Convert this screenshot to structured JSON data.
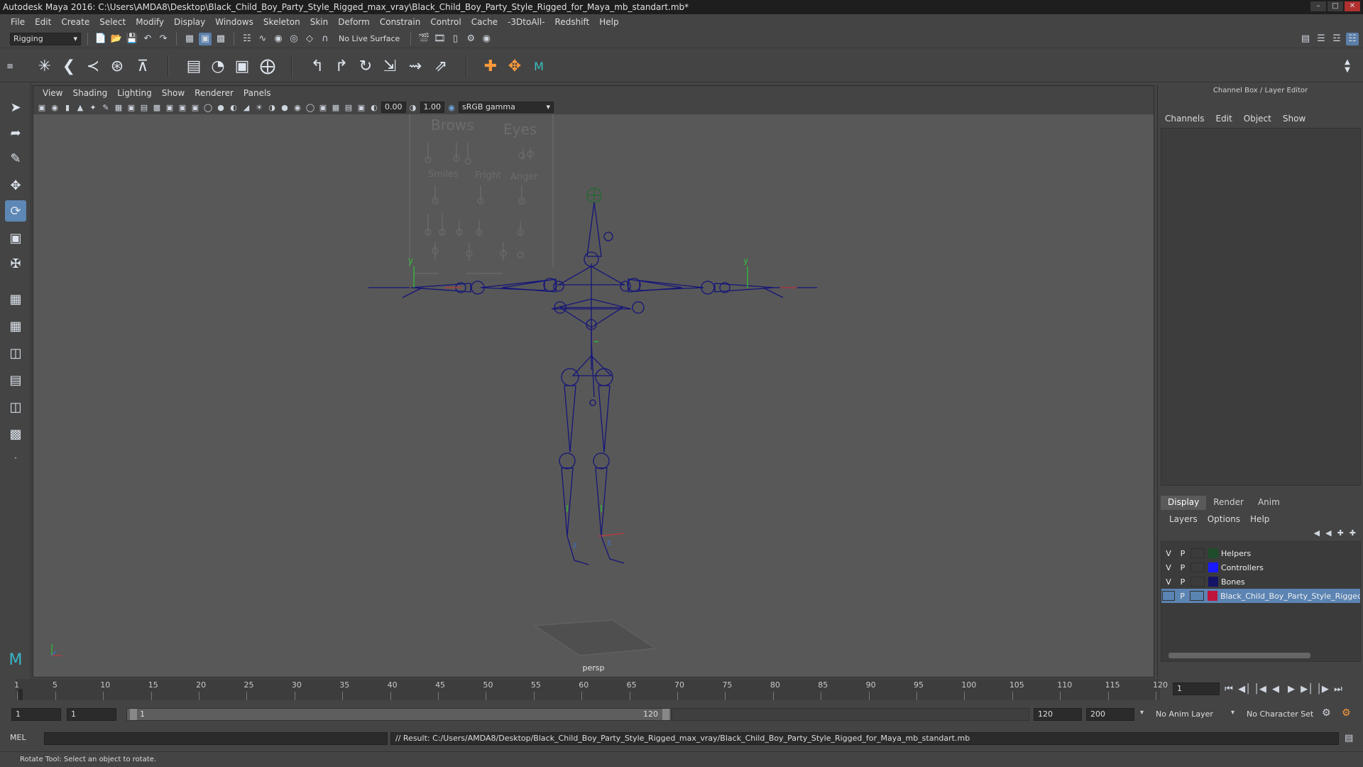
{
  "window": {
    "title": "Autodesk Maya 2016: C:\\Users\\AMDA8\\Desktop\\Black_Child_Boy_Party_Style_Rigged_max_vray\\Black_Child_Boy_Party_Style_Rigged_for_Maya_mb_standart.mb*"
  },
  "menubar": [
    "File",
    "Edit",
    "Create",
    "Select",
    "Modify",
    "Display",
    "Windows",
    "Skeleton",
    "Skin",
    "Deform",
    "Constrain",
    "Control",
    "Cache",
    "-3DtoAll-",
    "Redshift",
    "Help"
  ],
  "statusline": {
    "menuset": "Rigging",
    "live_surface": "No Live Surface"
  },
  "viewport": {
    "menus": [
      "View",
      "Shading",
      "Lighting",
      "Show",
      "Renderer",
      "Panels"
    ],
    "exposure": "0.00",
    "gamma": "1.00",
    "color_space": "sRGB gamma",
    "camera": "persp",
    "facial_ui_labels": [
      "Brows",
      "Eyes",
      "Smiles",
      "Fright",
      "Anger"
    ],
    "axis_y": "y",
    "axis_z": "z"
  },
  "channelbox": {
    "title": "Channel Box / Layer Editor",
    "menus": [
      "Channels",
      "Edit",
      "Object",
      "Show"
    ]
  },
  "layer_editor": {
    "tabs": [
      "Display",
      "Render",
      "Anim"
    ],
    "menus": [
      "Layers",
      "Options",
      "Help"
    ],
    "layers": [
      {
        "v": "V",
        "p": "P",
        "name": "Helpers",
        "color": "#1e4d2b"
      },
      {
        "v": "V",
        "p": "P",
        "name": "Controllers",
        "color": "#1a1aff"
      },
      {
        "v": "V",
        "p": "P",
        "name": "Bones",
        "color": "#141466"
      },
      {
        "v": "",
        "p": "P",
        "name": "Black_Child_Boy_Party_Style_Rigged",
        "color": "#c0143c"
      }
    ]
  },
  "timeslider": {
    "ticks": [
      "1",
      "5",
      "10",
      "15",
      "20",
      "25",
      "30",
      "35",
      "40",
      "45",
      "50",
      "55",
      "60",
      "65",
      "70",
      "75",
      "80",
      "85",
      "90",
      "95",
      "100",
      "105",
      "110",
      "115",
      "120"
    ],
    "current_frame": "1"
  },
  "rangeslider": {
    "start": "1",
    "anim_start": "1",
    "range_start": "1",
    "range_end": "120",
    "end": "120",
    "anim_end": "200",
    "anim_layer": "No Anim Layer",
    "character_set": "No Character Set"
  },
  "cmdline": {
    "lang": "MEL",
    "result": "// Result: C:/Users/AMDA8/Desktop/Black_Child_Boy_Party_Style_Rigged_max_vray/Black_Child_Boy_Party_Style_Rigged_for_Maya_mb_standart.mb"
  },
  "helpline": "Rotate Tool: Select an object to rotate."
}
